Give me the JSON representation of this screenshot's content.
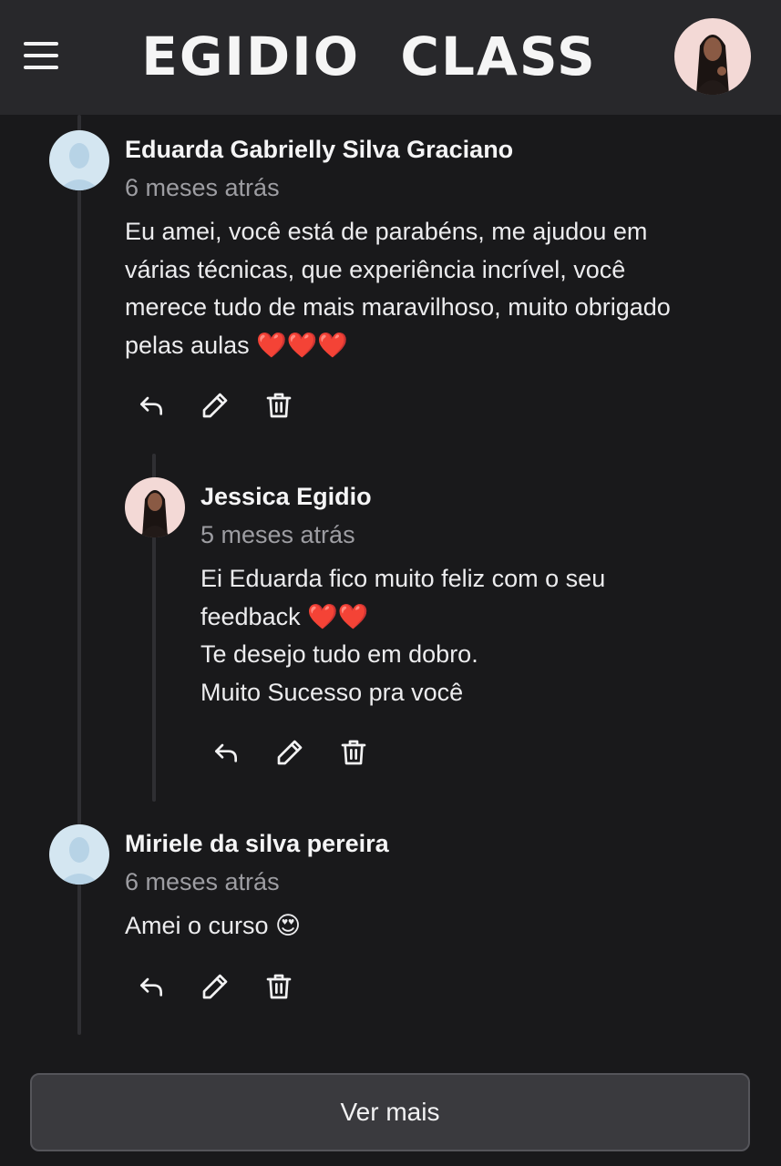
{
  "header": {
    "logo_text": "EGIDIO  CLASS",
    "menu_icon": "hamburger-menu-icon",
    "profile_icon": "user-photo-avatar"
  },
  "comments": [
    {
      "author": "Eduarda Gabrielly Silva Graciano",
      "time": "6 meses atrás",
      "lines": [
        "Eu amei, você está de parabéns, me ajudou em",
        "várias técnicas, que experiência incrível, você",
        "merece tudo de mais maravilhoso, muito obrigado",
        "pelas aulas ❤️❤️❤️"
      ],
      "reply": {
        "author": "Jessica Egidio",
        "time": "5 meses atrás",
        "lines": [
          "Ei Eduarda fico muito feliz com o seu",
          "feedback ❤️❤️",
          "Te desejo tudo em dobro.",
          "Muito Sucesso pra você"
        ]
      }
    },
    {
      "author": "Miriele da silva pereira",
      "time": "6 meses atrás",
      "lines": [
        "Amei o curso 😍"
      ]
    }
  ],
  "actions": {
    "reply_icon": "reply-icon",
    "edit_icon": "pencil-icon",
    "delete_icon": "trash-icon"
  },
  "load_more_label": "Ver mais",
  "colors": {
    "background": "#19191b",
    "header": "#28282b",
    "text": "#f2f2f3",
    "muted": "#9d9da2",
    "button": "#3a3a3e"
  }
}
